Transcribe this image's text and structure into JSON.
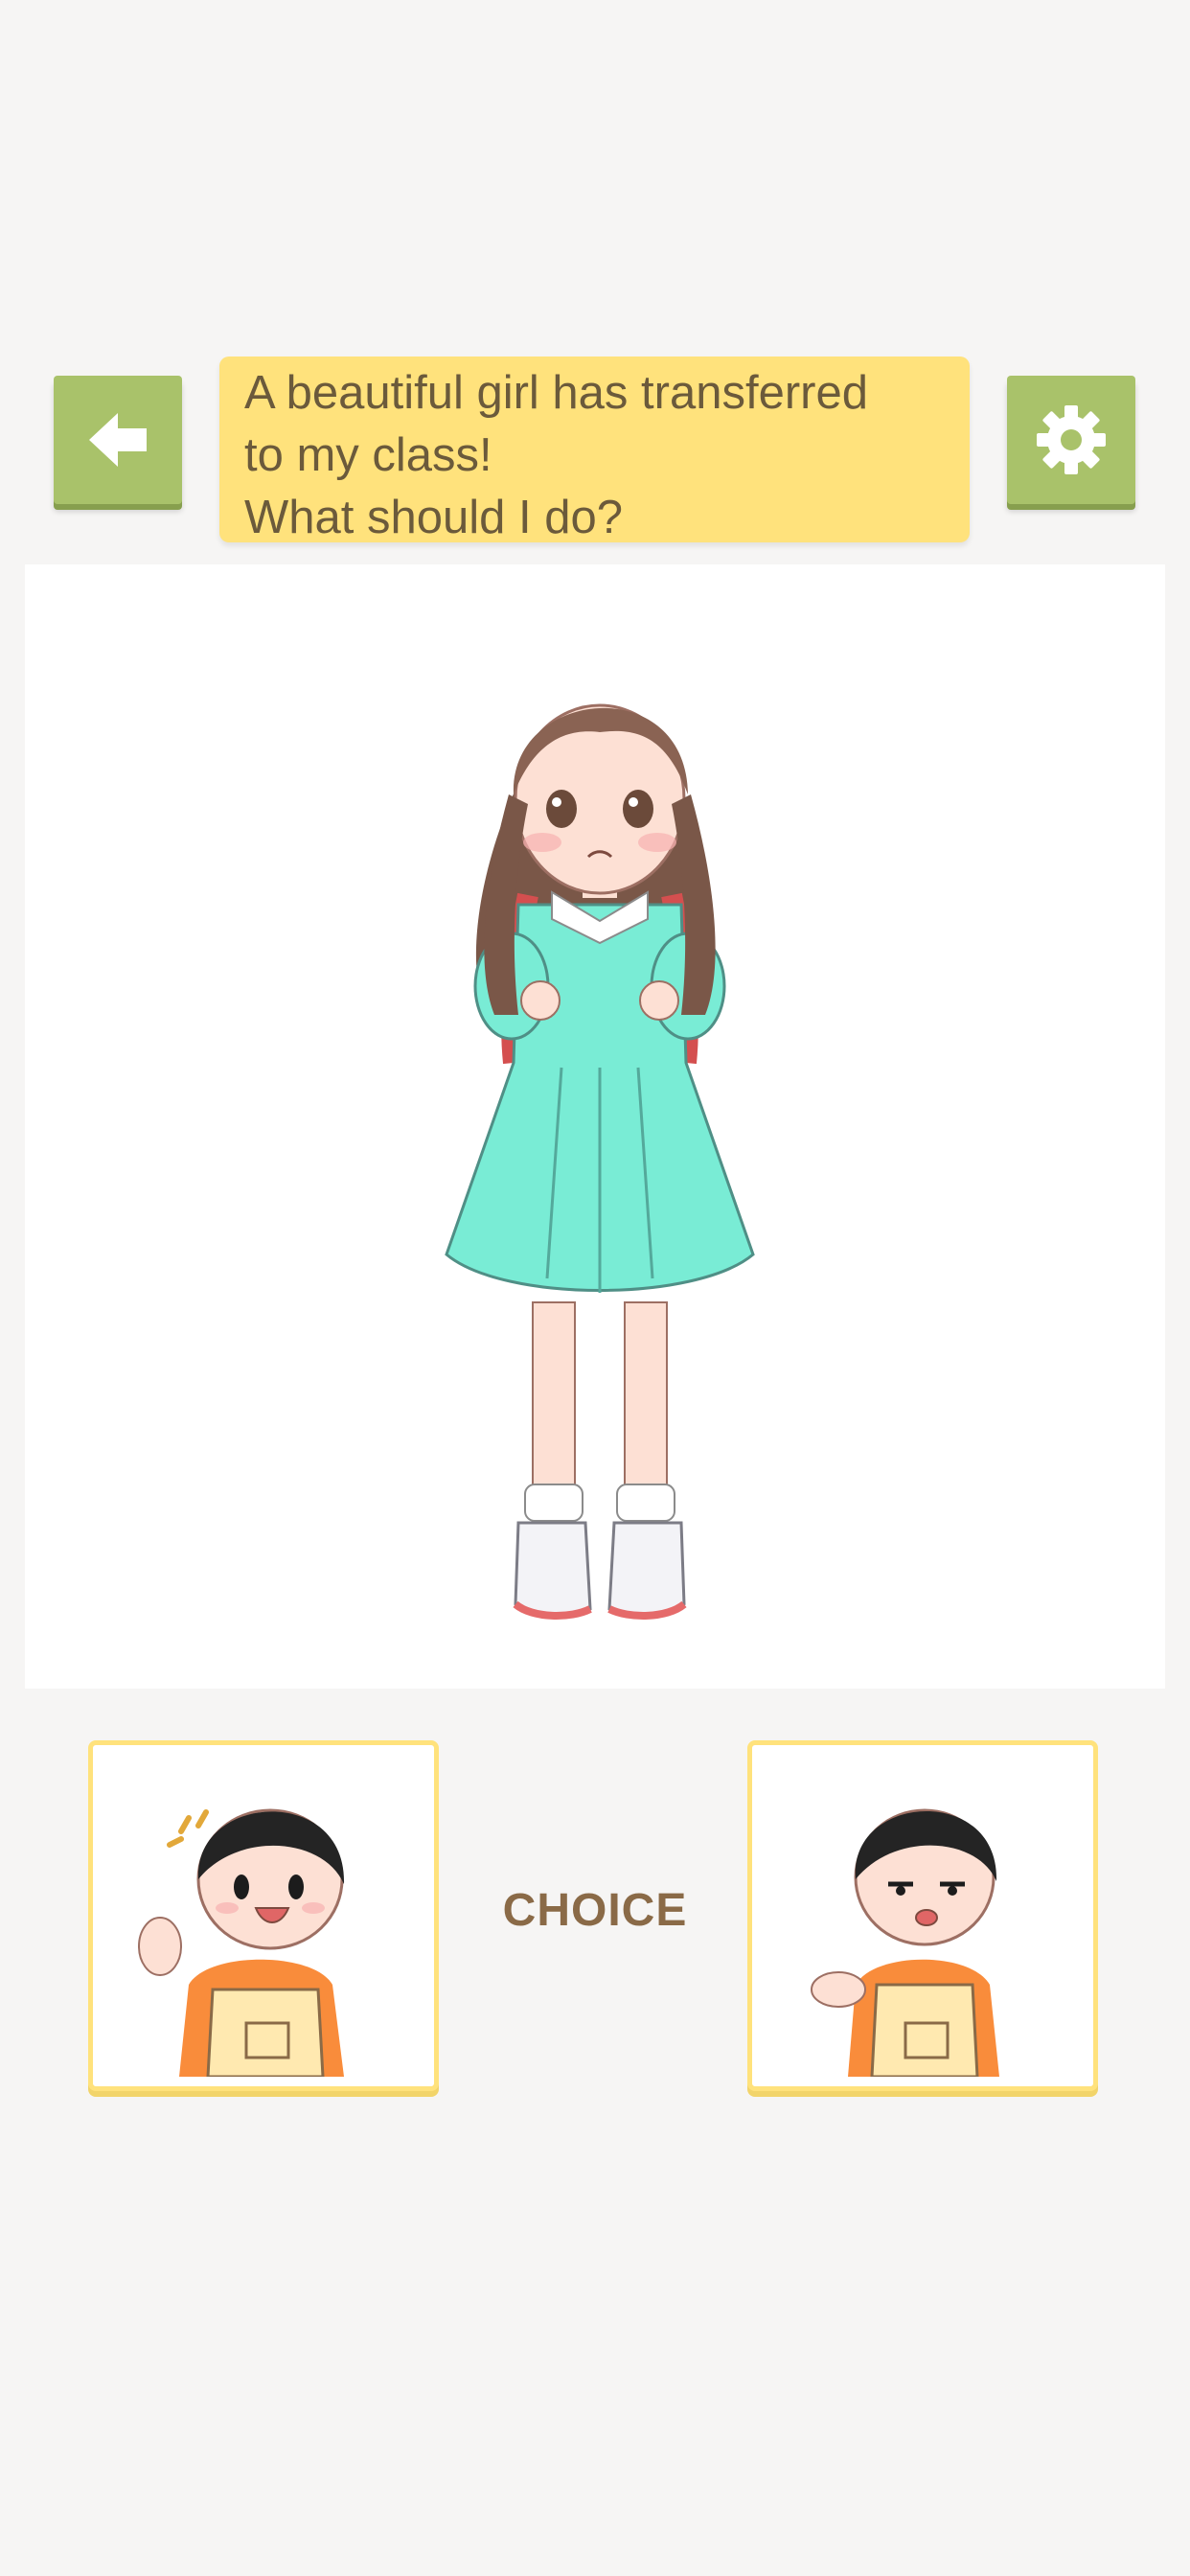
{
  "header": {
    "back_icon": "arrow-left-icon",
    "settings_icon": "gear-icon",
    "prompt_lines": [
      "A beautiful girl has transferred",
      "to my class!",
      "What should I do?"
    ]
  },
  "choices": {
    "label": "CHOICE",
    "left": {
      "description": "cheerful-waving-boy"
    },
    "right": {
      "description": "unimpressed-shrugging-boy"
    }
  },
  "colors": {
    "button_green": "#a9c26a",
    "prompt_yellow": "#ffe27c",
    "text_brown": "#6b5a3b",
    "choice_label": "#8a6a47"
  }
}
